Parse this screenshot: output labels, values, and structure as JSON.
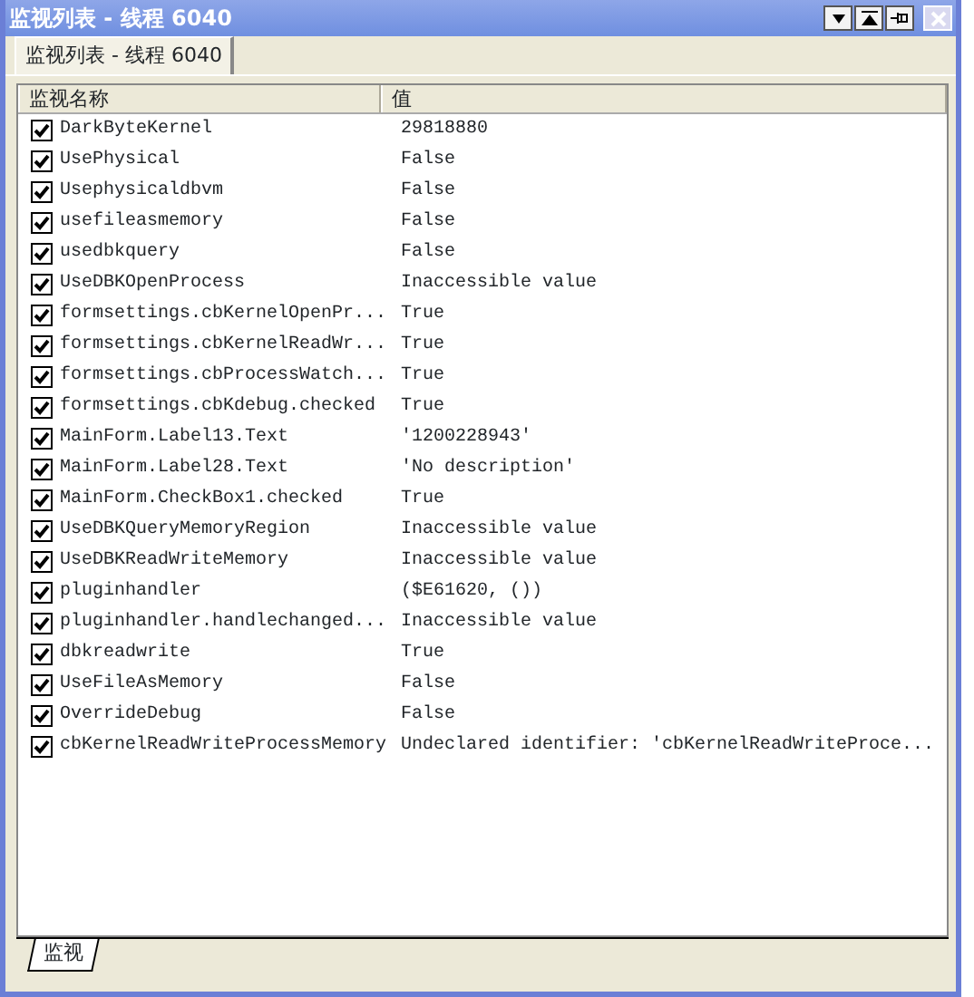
{
  "window": {
    "title": "监视列表 - 线程 6040"
  },
  "tabs": [
    {
      "label": "监视列表 - 线程 6040",
      "selected": true
    }
  ],
  "table": {
    "columns": [
      "监视名称",
      "值"
    ],
    "rows": [
      {
        "checked": true,
        "name": "DarkByteKernel",
        "value": "29818880"
      },
      {
        "checked": true,
        "name": "UsePhysical",
        "value": "False"
      },
      {
        "checked": true,
        "name": "Usephysicaldbvm",
        "value": "False"
      },
      {
        "checked": true,
        "name": "usefileasmemory",
        "value": "False"
      },
      {
        "checked": true,
        "name": "usedbkquery",
        "value": "False"
      },
      {
        "checked": true,
        "name": "UseDBKOpenProcess",
        "value": "Inaccessible value"
      },
      {
        "checked": true,
        "name": "formsettings.cbKernelOpenPr...",
        "value": "True"
      },
      {
        "checked": true,
        "name": "formsettings.cbKernelReadWr...",
        "value": "True"
      },
      {
        "checked": true,
        "name": "formsettings.cbProcessWatch...",
        "value": "True"
      },
      {
        "checked": true,
        "name": "formsettings.cbKdebug.checked",
        "value": "True"
      },
      {
        "checked": true,
        "name": "MainForm.Label13.Text",
        "value": "'1200228943'"
      },
      {
        "checked": true,
        "name": "MainForm.Label28.Text",
        "value": "'No description'"
      },
      {
        "checked": true,
        "name": "MainForm.CheckBox1.checked",
        "value": "True"
      },
      {
        "checked": true,
        "name": "UseDBKQueryMemoryRegion",
        "value": "Inaccessible value"
      },
      {
        "checked": true,
        "name": "UseDBKReadWriteMemory",
        "value": "Inaccessible value"
      },
      {
        "checked": true,
        "name": "pluginhandler",
        "value": "($E61620, ())"
      },
      {
        "checked": true,
        "name": "pluginhandler.handlechanged...",
        "value": "Inaccessible value"
      },
      {
        "checked": true,
        "name": "dbkreadwrite",
        "value": "True"
      },
      {
        "checked": true,
        "name": "UseFileAsMemory",
        "value": "False"
      },
      {
        "checked": true,
        "name": "OverrideDebug",
        "value": "False"
      },
      {
        "checked": true,
        "name": "cbKernelReadWriteProcessMemory",
        "value": "Undeclared identifier: 'cbKernelReadWriteProce..."
      }
    ]
  },
  "bottom_tabs": [
    {
      "label": "监视",
      "selected": true
    }
  ]
}
